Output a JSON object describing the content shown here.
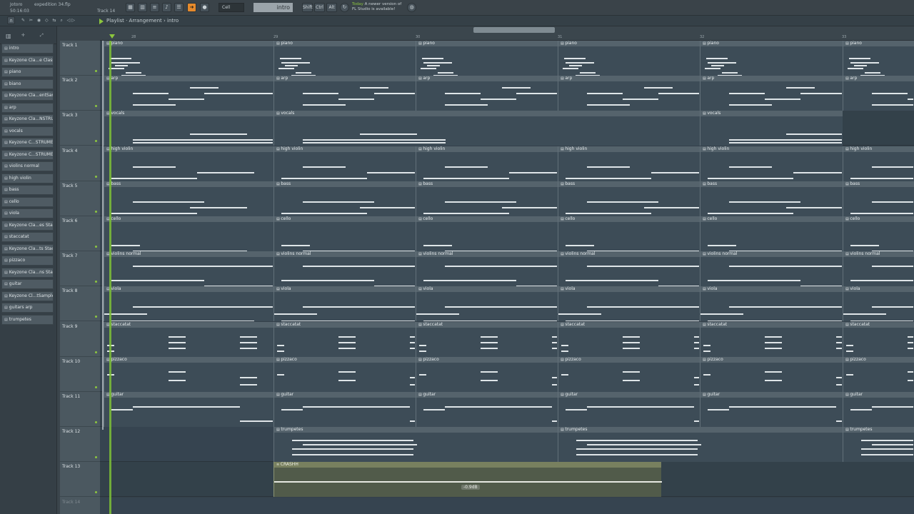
{
  "toolbar": {
    "project_name": "expedition 34.flp",
    "menu": "Jotoro",
    "time": "50:16:03",
    "track_label": "Track 14",
    "snap_label": "Cell",
    "pattern_label": "intro",
    "keys": [
      "Shift",
      "Ctrl",
      "Alt"
    ],
    "hint_today": "Today",
    "hint_message": "A newer version of",
    "hint_message2": "FL Studio is available!"
  },
  "playlist": {
    "breadcrumb": "Playlist · Arrangement › intro",
    "bar_numbers": [
      "28",
      "29",
      "30",
      "31",
      "32",
      "33"
    ]
  },
  "picker": {
    "items": [
      {
        "label": "intro",
        "type": "pattern"
      },
      {
        "label": "Keyzone Cla...e Classic #2",
        "type": "pattern"
      },
      {
        "label": "piano",
        "type": "pattern"
      },
      {
        "label": "biano",
        "type": "pattern"
      },
      {
        "label": "Keyzone Cla...entSampler",
        "type": "pattern"
      },
      {
        "label": "arp",
        "type": "pattern"
      },
      {
        "label": "Keyzone Cla...NSTRUMENT",
        "type": "pattern"
      },
      {
        "label": "vocals",
        "type": "pattern"
      },
      {
        "label": "Keyzone C...STRUMENT #2",
        "type": "pattern"
      },
      {
        "label": "Keyzone C...STRUMENT #3",
        "type": "pattern"
      },
      {
        "label": "violins normal",
        "type": "pattern"
      },
      {
        "label": "high violin",
        "type": "pattern"
      },
      {
        "label": "bass",
        "type": "pattern"
      },
      {
        "label": "cello",
        "type": "pattern"
      },
      {
        "label": "viola",
        "type": "pattern"
      },
      {
        "label": "Keyzone Cla...es Staccato",
        "type": "pattern"
      },
      {
        "label": "staccatat",
        "type": "pattern"
      },
      {
        "label": "Keyzone Cla...ts Staccato",
        "type": "pattern"
      },
      {
        "label": "pizzaco",
        "type": "pattern"
      },
      {
        "label": "Keyzone Cla...ns Staccato",
        "type": "pattern"
      },
      {
        "label": "guitar",
        "type": "pattern"
      },
      {
        "label": "Keyzone Cl...tSampler #8",
        "type": "pattern"
      },
      {
        "label": "guitars arp",
        "type": "pattern"
      },
      {
        "label": "trumpetes",
        "type": "pattern"
      }
    ]
  },
  "tracks": [
    {
      "name": "Track 1",
      "clip": "piano"
    },
    {
      "name": "Track 2",
      "clip": "arp"
    },
    {
      "name": "Track 3",
      "clip": "vocals"
    },
    {
      "name": "Track 4",
      "clip": "high violin"
    },
    {
      "name": "Track 5",
      "clip": "bass"
    },
    {
      "name": "Track 6",
      "clip": "cello"
    },
    {
      "name": "Track 7",
      "clip": "violins normal"
    },
    {
      "name": "Track 8",
      "clip": "viola"
    },
    {
      "name": "Track 9",
      "clip": "staccatat"
    },
    {
      "name": "Track 10",
      "clip": "pizzaco"
    },
    {
      "name": "Track 11",
      "clip": "guitar"
    },
    {
      "name": "Track 12",
      "clip": "trumpetes"
    },
    {
      "name": "Track 13",
      "clip": "CRASHH"
    },
    {
      "name": "Track 14",
      "clip": ""
    }
  ],
  "audio_clip": {
    "label": "CRASHH",
    "volume": "-0.9dB"
  },
  "colors": {
    "accent": "#8cc63e",
    "orange": "#e58a2c"
  }
}
